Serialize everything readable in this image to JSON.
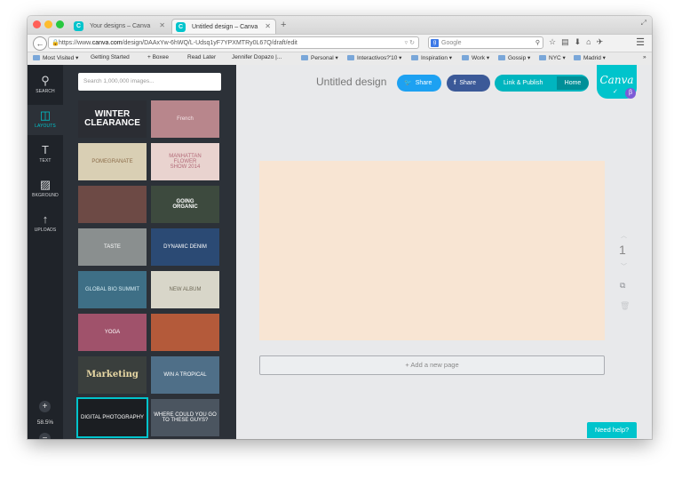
{
  "browser": {
    "tabs": [
      {
        "title": "Your designs – Canva",
        "favicon": "C",
        "active": false
      },
      {
        "title": "Untitled design – Canva",
        "favicon": "C",
        "active": true
      }
    ],
    "new_tab": "+",
    "back_icon": "←",
    "url": {
      "prefix": "https://www.",
      "domain": "canva.com",
      "path": "/design/DAAxYw-6hWQ/L-Udsq1yF7YPXMTRy0L67Q/draft/edit"
    },
    "reload_icon": "C",
    "search_engine": "Google",
    "toolbar_icons": [
      "star-icon",
      "clipboard-icon",
      "download-icon",
      "home-icon",
      "extension-icon",
      "menu-icon"
    ],
    "bookmarks": [
      {
        "label": "Most Visited ▾",
        "type": "folder"
      },
      {
        "label": "Getting Started",
        "type": "page"
      },
      {
        "label": "+ Boxee",
        "type": "page"
      },
      {
        "label": "Read Later",
        "type": "page"
      },
      {
        "label": "Jennifer Dopazo |...",
        "type": "page"
      },
      {
        "label": "Personal ▾",
        "type": "folder"
      },
      {
        "label": "Interactivos?'10 ▾",
        "type": "folder"
      },
      {
        "label": "Inspiration ▾",
        "type": "folder"
      },
      {
        "label": "Work ▾",
        "type": "folder"
      },
      {
        "label": "Gossip ▾",
        "type": "folder"
      },
      {
        "label": "NYC ▾",
        "type": "folder"
      },
      {
        "label": "Madrid ▾",
        "type": "folder"
      }
    ],
    "bookmarks_overflow": "»"
  },
  "sidebar": {
    "items": [
      {
        "label": "SEARCH",
        "icon": "search-icon",
        "glyph": "⚲",
        "active": false
      },
      {
        "label": "LAYOUTS",
        "icon": "layouts-icon",
        "glyph": "◫",
        "active": true
      },
      {
        "label": "TEXT",
        "icon": "text-icon",
        "glyph": "T",
        "active": false
      },
      {
        "label": "BKGROUND",
        "icon": "background-icon",
        "glyph": "▨",
        "active": false
      },
      {
        "label": "UPLOADS",
        "icon": "upload-icon",
        "glyph": "↑",
        "active": false
      }
    ],
    "zoom_in": "+",
    "zoom_level": "58.5%",
    "zoom_out": "−"
  },
  "panel": {
    "search_placeholder": "Search 1,000,000 images...",
    "layouts": [
      {
        "text": "WINTER\nCLEARANCE",
        "bg": "#2b2d33",
        "color": "#ffffff"
      },
      {
        "text": "French",
        "bg": "#b8868c",
        "color": "#f5e6e8"
      },
      {
        "text": "POMEGRANATE",
        "bg": "#d9cfb4",
        "color": "#8d6e4b"
      },
      {
        "text": "MANHATTAN\nFLOWER\nSHOW 2014",
        "bg": "#e9d3cf",
        "color": "#b26a78"
      },
      {
        "text": "",
        "bg": "#6d4a45",
        "color": "#ffffff"
      },
      {
        "text": "GOING\nORGANIC",
        "bg": "#3d4a3e",
        "color": "#ffffff"
      },
      {
        "text": "TASTE",
        "bg": "#8a8f8f",
        "color": "#ffffff"
      },
      {
        "text": "DYNAMIC DENIM",
        "bg": "#2b4a74",
        "color": "#ffffff"
      },
      {
        "text": "GLOBAL BIO SUMMIT",
        "bg": "#3e6f86",
        "color": "#d8eef5"
      },
      {
        "text": "NEW ALBUM",
        "bg": "#d8d6c9",
        "color": "#6f6a58"
      },
      {
        "text": "YOGA",
        "bg": "#a0526b",
        "color": "#ffffff"
      },
      {
        "text": "",
        "bg": "#b45a3a",
        "color": "#ffffff"
      },
      {
        "text": "Marketing",
        "bg": "#3a3f3d",
        "color": "#e9d9a5"
      },
      {
        "text": "WIN A TROPICAL",
        "bg": "#4f6f88",
        "color": "#ffffff"
      },
      {
        "text": "DIGITAL PHOTOGRAPHY",
        "bg": "#1b1e22",
        "color": "#ffffff"
      },
      {
        "text": "WHERE COULD YOU GO TO THESE GUYS?",
        "bg": "#4b5560",
        "color": "#ffffff"
      }
    ]
  },
  "editor": {
    "title": "Untitled design",
    "twitter_share": "Share",
    "facebook_share": "Share",
    "link_publish": "Link & Publish",
    "home": "Home",
    "logo": "Canva",
    "beta": "β",
    "add_page": "+ Add a new page",
    "page_number": "1",
    "need_help": "Need help?",
    "colors": {
      "accent": "#00c4cc",
      "twitter": "#1da1f2",
      "facebook": "#3b5998",
      "page": "#f8e5d3"
    }
  }
}
